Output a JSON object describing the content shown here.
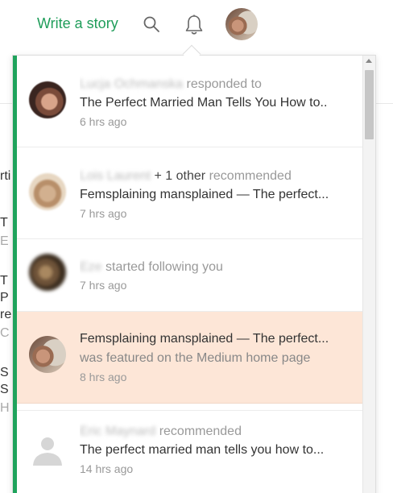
{
  "nav": {
    "write_story": "Write a story",
    "search_icon": "search-icon",
    "bell_icon": "bell-icon",
    "brand_color": "#1f9d5a"
  },
  "background_page": {
    "fragments": [
      "rti",
      "T",
      "E",
      "T",
      "P",
      "re",
      "C",
      "S",
      "S",
      "H"
    ]
  },
  "notifications": [
    {
      "name": "Lucja Ochmanska",
      "action": "responded to",
      "extra": "",
      "title": "The Perfect Married Man Tells You How to..",
      "subtitle": "",
      "time": "6 hrs ago",
      "highlighted": false
    },
    {
      "name": "Lois Laurent",
      "action": "recommended",
      "extra": "+ 1 other",
      "title": "Femsplaining mansplained — The perfect...",
      "subtitle": "",
      "time": "7 hrs ago",
      "highlighted": false
    },
    {
      "name": "Eze",
      "action": "started following you",
      "extra": "",
      "title": "",
      "subtitle": "",
      "time": "7 hrs ago",
      "highlighted": false
    },
    {
      "name": "",
      "action": "",
      "extra": "",
      "title": "Femsplaining mansplained — The perfect...",
      "subtitle": "was featured on the Medium home page",
      "time": "8 hrs ago",
      "highlighted": true
    },
    {
      "name": "Eric Maynard",
      "action": "recommended",
      "extra": "",
      "title": "The perfect married man tells you how to...",
      "subtitle": "",
      "time": "14 hrs ago",
      "highlighted": false
    }
  ],
  "colors": {
    "accent": "#1fa35c",
    "highlight": "#fde6d7"
  }
}
